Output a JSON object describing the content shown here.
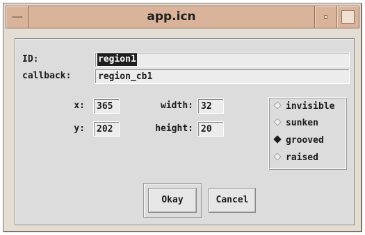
{
  "window": {
    "title": "app.icn",
    "titlebar_color": "#d9b49b",
    "frame_color": "#e4ddd4",
    "icons": {
      "menu": "window-menu-icon",
      "minimize": "minimize-icon",
      "maximize": "maximize-icon"
    }
  },
  "form": {
    "id_label": "ID:",
    "id_value": "region1",
    "callback_label": "callback:",
    "callback_value": "region_cb1",
    "x_label": "x:",
    "x_value": "365",
    "y_label": "y:",
    "y_value": "202",
    "width_label": "width:",
    "width_value": "32",
    "height_label": "height:",
    "height_value": "20"
  },
  "style_options": [
    {
      "label": "invisible",
      "selected": false
    },
    {
      "label": "sunken",
      "selected": false
    },
    {
      "label": "grooved",
      "selected": true
    },
    {
      "label": "raised",
      "selected": false
    }
  ],
  "buttons": {
    "okay": "Okay",
    "cancel": "Cancel"
  }
}
